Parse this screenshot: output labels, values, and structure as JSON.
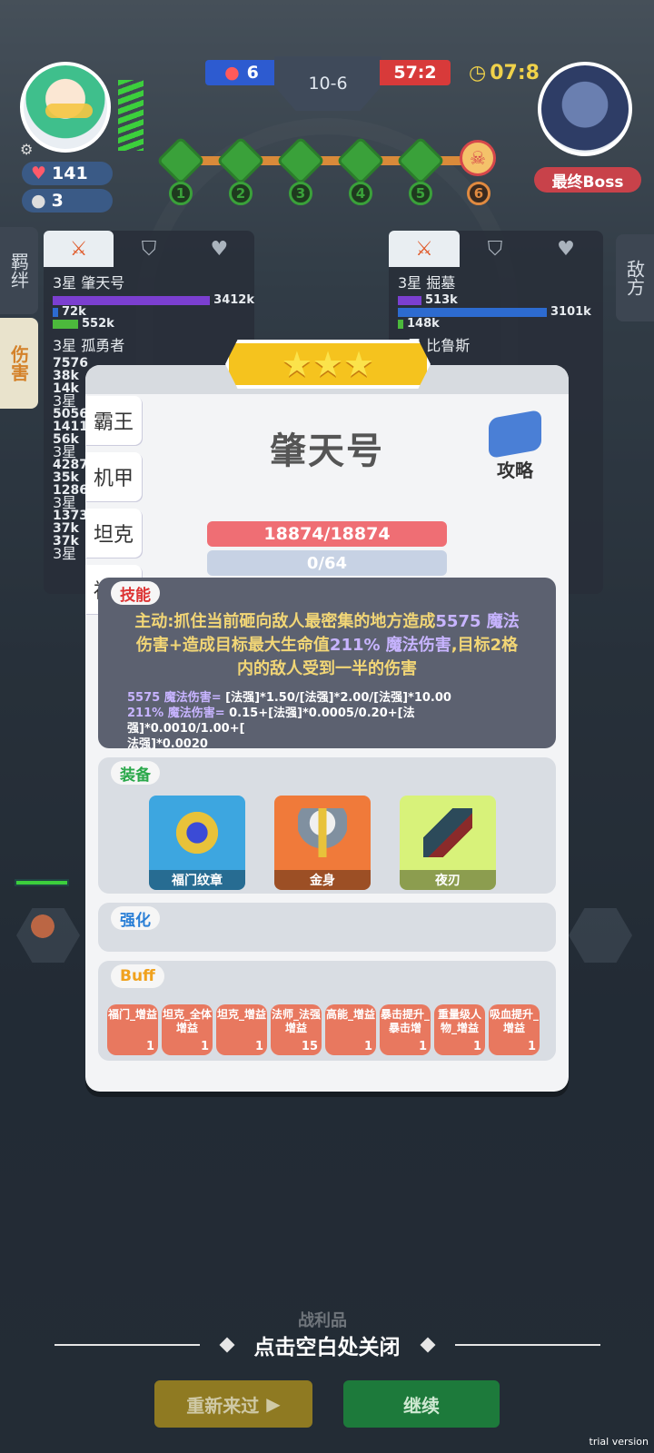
{
  "top": {
    "player_hp": "141",
    "player_coins": "3",
    "blue_score": "6",
    "round": "10-6",
    "red_score": "57:2",
    "timer": "07:8",
    "boss_label": "最终Boss",
    "stages": [
      "1",
      "2",
      "3",
      "4",
      "5",
      "6"
    ]
  },
  "side_tabs": {
    "left_bond": "羁绊",
    "left_damage": "伤害",
    "right_enemy": "敌方"
  },
  "left_panel": {
    "rows": [
      {
        "name": "3星 肇天号",
        "v1": "3412k",
        "v2": "72k",
        "v3": "552k"
      },
      {
        "name": "3星 孤勇者",
        "v1": "7576",
        "v2": "38k",
        "v3": "14k"
      }
    ],
    "stubs": [
      "3星",
      "5056",
      "1411",
      "56k",
      "3星",
      "4287",
      "35k",
      "1286",
      "3星",
      "1373",
      "37k",
      "37k",
      "3星"
    ]
  },
  "right_panel": {
    "rows": [
      {
        "name": "3星 掘墓",
        "v1": "513k",
        "v2": "3101k",
        "v3": "148k"
      },
      {
        "name": "3星 比鲁斯"
      }
    ]
  },
  "modal": {
    "stars": "★★★",
    "categories": [
      "霸王",
      "机甲",
      "坦克",
      "福门"
    ],
    "hero_name": "肇天号",
    "guide_label": "攻略",
    "hp": "18874/18874",
    "mp": "0/64",
    "skill": {
      "label": "技能",
      "line1_a": "主动:抓住当前砸向敌人最密集的地方造成",
      "line1_num": "5575 魔法",
      "line2_a": "伤害+造成目标最大生命值",
      "line2_num": "211% 魔法伤害",
      "line2_b": ",目标2格",
      "line3": "内的敌人受到一半的伤害",
      "formula1_a": "5575 魔法伤害=",
      "formula1_b": " [法强]*1.50/[法强]*2.00/[法强]*10.00",
      "formula2_a": "211% 魔法伤害=",
      "formula2_b": " 0.15+[法强]*0.0005/0.20+[法强]*0.0010/1.00+[",
      "formula3": "法强]*0.0020"
    },
    "equip": {
      "label": "装备",
      "items": [
        "福门纹章",
        "金身",
        "夜刃"
      ]
    },
    "enhance_label": "强化",
    "buff": {
      "label": "Buff",
      "items": [
        {
          "name": "福门_增益",
          "count": "1"
        },
        {
          "name": "坦克_全体增益",
          "count": "1"
        },
        {
          "name": "坦克_增益",
          "count": "1"
        },
        {
          "name": "法师_法强增益",
          "count": "15"
        },
        {
          "name": "高能_增益",
          "count": "1"
        },
        {
          "name": "暴击提升_暴击增",
          "count": "1"
        },
        {
          "name": "重量级人物_增益",
          "count": "1"
        },
        {
          "name": "吸血提升_增益",
          "count": "1"
        }
      ]
    }
  },
  "bottom": {
    "spoils": "战利品",
    "close_hint": "点击空白处关闭",
    "retry": "重新来过",
    "continue": "继续",
    "trial": "trial version"
  },
  "colors": {
    "hp_bar": "#ef6e74",
    "mp_bar": "#c7d2e4",
    "skill_bg": "#5c6170",
    "star_ribbon": "#f5c31e",
    "retry": "#8f7a22",
    "continue": "#1d7a3b"
  }
}
